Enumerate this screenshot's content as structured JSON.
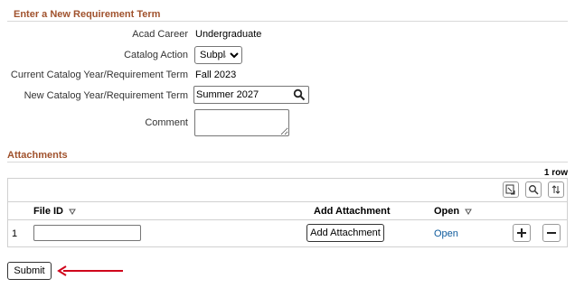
{
  "requirement_section": {
    "title": "Enter a New Requirement Term",
    "acad_career_label": "Acad Career",
    "acad_career_value": "Undergraduate",
    "catalog_action_label": "Catalog Action",
    "catalog_action_value": "Subplan",
    "current_term_label": "Current Catalog Year/Requirement Term",
    "current_term_value": "Fall 2023",
    "new_term_label": "New Catalog Year/Requirement Term",
    "new_term_value": "Summer 2027",
    "comment_label": "Comment",
    "comment_value": ""
  },
  "attachments_section": {
    "title": "Attachments",
    "row_count": "1 row",
    "columns": {
      "file_id": "File ID",
      "add_attachment": "Add Attachment",
      "open": "Open"
    },
    "rows": [
      {
        "row_number": "1",
        "file_id": "",
        "add_attachment_label": "Add Attachment",
        "open_label": "Open"
      }
    ]
  },
  "actions": {
    "submit_label": "Submit"
  },
  "colors": {
    "section_title": "#a0522d",
    "link": "#0d5a9c",
    "annotation_arrow": "#d0021b"
  },
  "icons": [
    "magnifier-icon",
    "export-icon",
    "search-icon",
    "sort-icon",
    "plus-icon",
    "minus-icon",
    "arrow-icon"
  ]
}
